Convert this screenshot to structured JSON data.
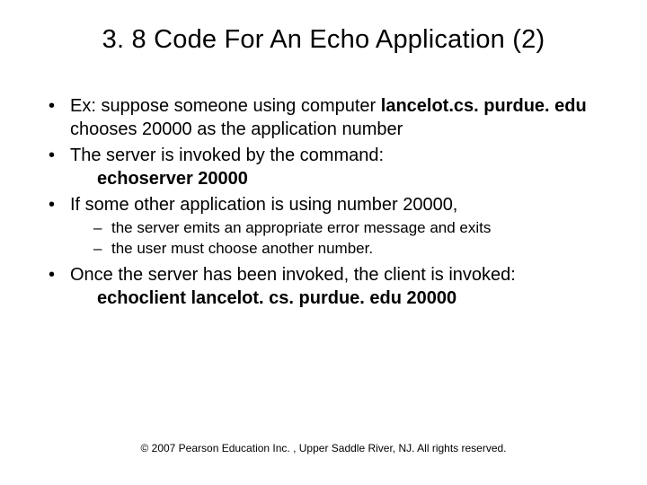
{
  "title": "3. 8 Code For An Echo Application (2)",
  "bullets": {
    "b1_pre": "Ex: suppose someone using computer ",
    "b1_bold": "lancelot.cs. purdue. edu",
    "b1_post": " chooses 20000 as the application number",
    "b2": "The server is invoked by the command:",
    "b2_cmd": "echoserver  20000",
    "b3": "If some other application is using number 20000,",
    "b3_sub1": "the server emits an appropriate error message and exits",
    "b3_sub2": "the user must choose another number.",
    "b4": "Once the server has been invoked, the client is invoked:",
    "b4_cmd": "echoclient  lancelot. cs. purdue. edu  20000"
  },
  "footer": "© 2007 Pearson Education Inc. , Upper Saddle River, NJ. All rights reserved."
}
